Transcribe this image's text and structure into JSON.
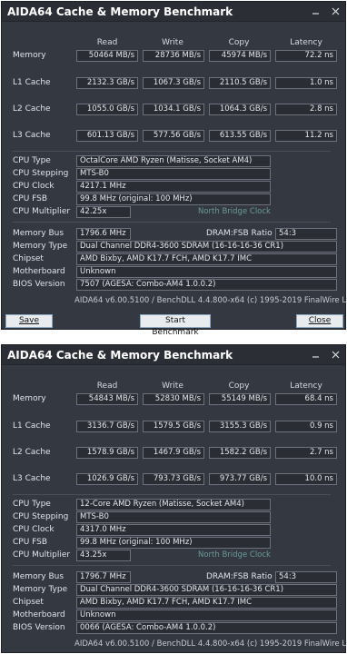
{
  "windows": [
    {
      "title": "AIDA64 Cache & Memory Benchmark",
      "columns": [
        "Read",
        "Write",
        "Copy",
        "Latency"
      ],
      "rows": [
        {
          "label": "Memory",
          "read": "50464 MB/s",
          "write": "28736 MB/s",
          "copy": "45974 MB/s",
          "latency": "72.2 ns"
        },
        {
          "label": "L1 Cache",
          "read": "2132.3 GB/s",
          "write": "1067.3 GB/s",
          "copy": "2110.5 GB/s",
          "latency": "1.0 ns"
        },
        {
          "label": "L2 Cache",
          "read": "1055.0 GB/s",
          "write": "1034.1 GB/s",
          "copy": "1064.3 GB/s",
          "latency": "2.8 ns"
        },
        {
          "label": "L3 Cache",
          "read": "601.13 GB/s",
          "write": "577.56 GB/s",
          "copy": "613.55 GB/s",
          "latency": "11.2 ns"
        }
      ],
      "info": {
        "cpu_type_label": "CPU Type",
        "cpu_type": "OctalCore AMD Ryzen  (Matisse, Socket AM4)",
        "cpu_stepping_label": "CPU Stepping",
        "cpu_stepping": "MTS-B0",
        "cpu_clock_label": "CPU Clock",
        "cpu_clock": "4217.1 MHz",
        "cpu_fsb_label": "CPU FSB",
        "cpu_fsb": "99.8 MHz  (original: 100 MHz)",
        "cpu_multiplier_label": "CPU Multiplier",
        "cpu_multiplier": "42.25x",
        "north_bridge_clock": "North Bridge Clock",
        "memory_bus_label": "Memory Bus",
        "memory_bus": "1796.6 MHz",
        "dram_fsb_ratio_label": "DRAM:FSB Ratio",
        "dram_fsb_ratio": "54:3",
        "memory_type_label": "Memory Type",
        "memory_type": "Dual Channel DDR4-3600 SDRAM  (16-16-16-36 CR1)",
        "chipset_label": "Chipset",
        "chipset": "AMD Bixby, AMD K17.7 FCH, AMD K17.7 IMC",
        "motherboard_label": "Motherboard",
        "motherboard": "Unknown",
        "bios_version_label": "BIOS Version",
        "bios_version": "7507  (AGESA: Combo-AM4 1.0.0.2)"
      },
      "footer": "AIDA64 v6.00.5100 / BenchDLL 4.4.800-x64  (c) 1995-2019 FinalWire Ltd.",
      "buttons": {
        "save": "Save",
        "start": "Start Benchmark",
        "close": "Close"
      }
    },
    {
      "title": "AIDA64 Cache & Memory Benchmark",
      "columns": [
        "Read",
        "Write",
        "Copy",
        "Latency"
      ],
      "rows": [
        {
          "label": "Memory",
          "read": "54843 MB/s",
          "write": "52830 MB/s",
          "copy": "55149 MB/s",
          "latency": "68.4 ns"
        },
        {
          "label": "L1 Cache",
          "read": "3136.7 GB/s",
          "write": "1579.5 GB/s",
          "copy": "3155.3 GB/s",
          "latency": "0.9 ns"
        },
        {
          "label": "L2 Cache",
          "read": "1578.9 GB/s",
          "write": "1467.9 GB/s",
          "copy": "1582.2 GB/s",
          "latency": "2.7 ns"
        },
        {
          "label": "L3 Cache",
          "read": "1026.9 GB/s",
          "write": "793.73 GB/s",
          "copy": "973.77 GB/s",
          "latency": "10.0 ns"
        }
      ],
      "info": {
        "cpu_type_label": "CPU Type",
        "cpu_type": "12-Core AMD Ryzen  (Matisse, Socket AM4)",
        "cpu_stepping_label": "CPU Stepping",
        "cpu_stepping": "MTS-B0",
        "cpu_clock_label": "CPU Clock",
        "cpu_clock": "4317.0 MHz",
        "cpu_fsb_label": "CPU FSB",
        "cpu_fsb": "99.8 MHz  (original: 100 MHz)",
        "cpu_multiplier_label": "CPU Multiplier",
        "cpu_multiplier": "43.25x",
        "north_bridge_clock": "North Bridge Clock",
        "memory_bus_label": "Memory Bus",
        "memory_bus": "1796.7 MHz",
        "dram_fsb_ratio_label": "DRAM:FSB Ratio",
        "dram_fsb_ratio": "54:3",
        "memory_type_label": "Memory Type",
        "memory_type": "Dual Channel DDR4-3600 SDRAM  (16-16-16-36 CR1)",
        "chipset_label": "Chipset",
        "chipset": "AMD Bixby, AMD K17.7 FCH, AMD K17.7 IMC",
        "motherboard_label": "Motherboard",
        "motherboard": "Unknown",
        "bios_version_label": "BIOS Version",
        "bios_version": "0066  (AGESA: Combo-AM4 1.0.0.2)"
      },
      "footer": "AIDA64 v6.00.5100 / BenchDLL 4.4.800-x64  (c) 1995-2019 FinalWire Ltd."
    }
  ],
  "icons": {
    "minimize": "minimize-icon",
    "close": "close-icon"
  }
}
